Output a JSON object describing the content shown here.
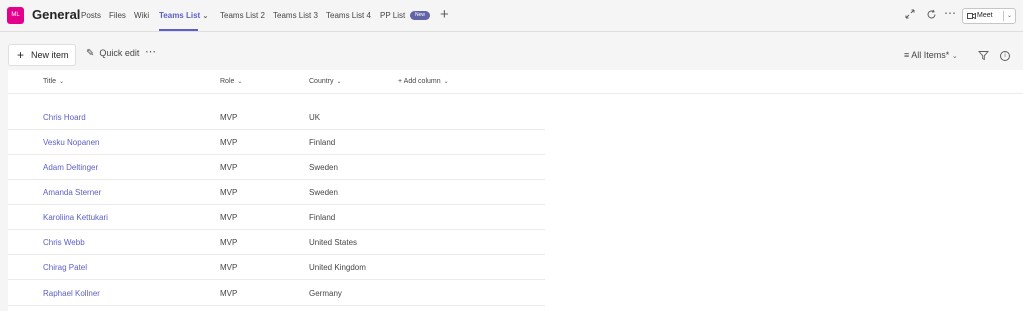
{
  "header": {
    "avatar_initials": "ML",
    "team_name": "General",
    "tabs": [
      {
        "label": "Posts"
      },
      {
        "label": "Files"
      },
      {
        "label": "Wiki"
      },
      {
        "label": "Teams List",
        "active": true
      },
      {
        "label": "Teams List 2"
      },
      {
        "label": "Teams List 3"
      },
      {
        "label": "Teams List 4"
      },
      {
        "label": "PP List"
      }
    ],
    "new_badge": "New",
    "meet_label": "Meet"
  },
  "commandbar": {
    "new_item_label": "New item",
    "quick_edit_label": "Quick edit",
    "view_label": "All Items*"
  },
  "list": {
    "columns": [
      "Title",
      "Role",
      "Country",
      "Add column"
    ],
    "rows": [
      {
        "title": "Chris Hoard",
        "role": "MVP",
        "country": "UK"
      },
      {
        "title": "Vesku Nopanen",
        "role": "MVP",
        "country": "Finland"
      },
      {
        "title": "Adam Deltinger",
        "role": "MVP",
        "country": "Sweden"
      },
      {
        "title": "Amanda Sterner",
        "role": "MVP",
        "country": "Sweden"
      },
      {
        "title": "Karoliina Kettukari",
        "role": "MVP",
        "country": "Finland"
      },
      {
        "title": "Chris Webb",
        "role": "MVP",
        "country": "United States"
      },
      {
        "title": "Chirag Patel",
        "role": "MVP",
        "country": "United Kingdom"
      },
      {
        "title": "Raphael Kollner",
        "role": "MVP",
        "country": "Germany"
      }
    ]
  },
  "colors": {
    "accent": "#5b5fc7",
    "avatar_bg": "#e3008c",
    "badge_bg": "#6264a7"
  },
  "icons": [
    "expand-icon",
    "refresh-icon",
    "more-options-icon",
    "video-camera-icon",
    "add-tab-icon",
    "pencil-icon",
    "view-lines-icon",
    "filter-icon",
    "info-icon"
  ]
}
